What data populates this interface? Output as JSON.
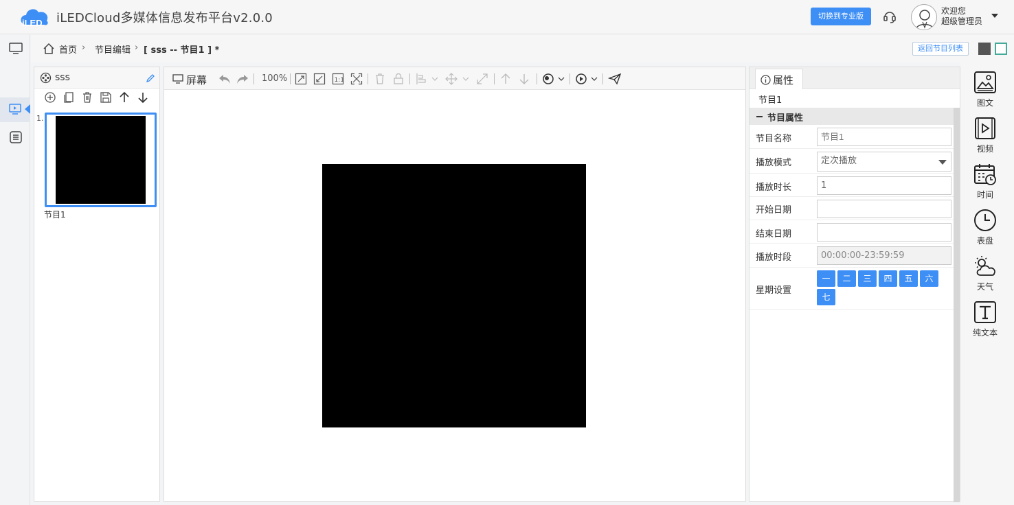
{
  "header": {
    "logo_text": "iLED",
    "title": "iLEDCloud多媒体信息发布平台v2.0.0",
    "pro_button": "切换到专业版",
    "welcome": "欢迎您",
    "user_role": "超级管理员"
  },
  "breadcrumb": {
    "home": "首页",
    "section": "节目编辑",
    "current": "[ sss -- 节目1 ] *",
    "back_button": "返回节目列表"
  },
  "left_panel": {
    "title": "sss",
    "thumb_index": "1.",
    "thumb_label": "节目1"
  },
  "center_panel": {
    "title": "屏幕",
    "zoom": "100%"
  },
  "right_panel": {
    "tab": "属性",
    "subtitle": "节目1",
    "section_title": "节目属性",
    "fields": {
      "name_label": "节目名称",
      "name_placeholder": "节目1",
      "mode_label": "播放模式",
      "mode_value": "定次播放",
      "duration_label": "播放时长",
      "duration_value": "1",
      "start_label": "开始日期",
      "start_value": "",
      "end_label": "结束日期",
      "end_value": "",
      "period_label": "播放时段",
      "period_value": "00:00:00-23:59:59",
      "week_label": "星期设置"
    },
    "days": [
      "一",
      "二",
      "三",
      "四",
      "五",
      "六",
      "七"
    ]
  },
  "right_toolbar": {
    "items": [
      "图文",
      "视频",
      "时间",
      "表盘",
      "天气",
      "纯文本"
    ]
  },
  "colors": {
    "accent": "#3d8ef5",
    "canvas": "#000000"
  }
}
